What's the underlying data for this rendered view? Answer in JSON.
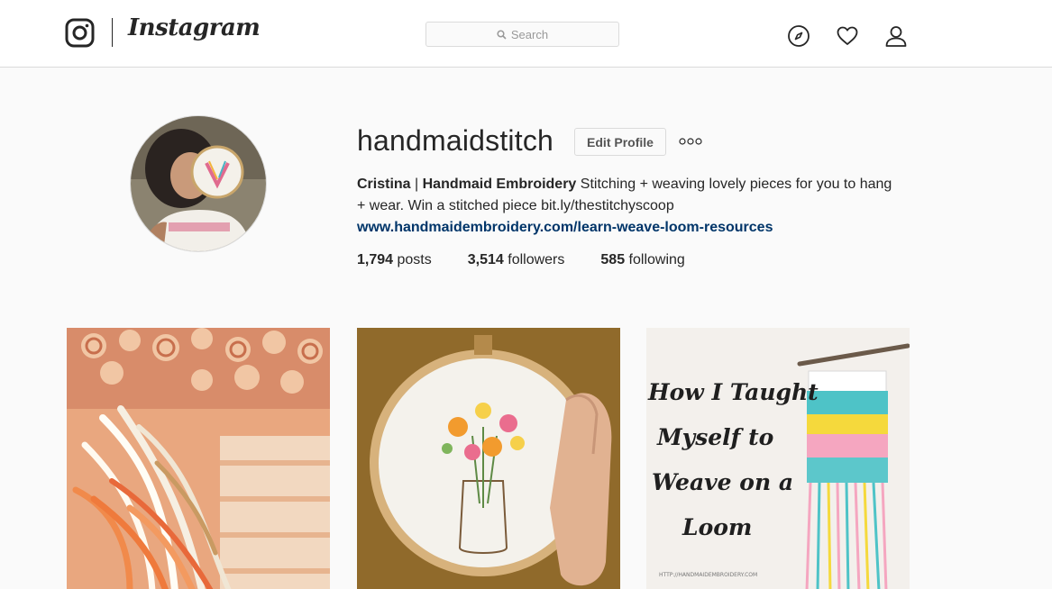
{
  "brand": {
    "wordmark": "Instagram",
    "logo_icon": "instagram-camera-icon"
  },
  "search": {
    "placeholder": "Search",
    "icon": "search-icon"
  },
  "nav": {
    "icons": [
      "compass-icon",
      "heart-icon",
      "person-icon"
    ]
  },
  "profile": {
    "username": "handmaidstitch",
    "edit_label": "Edit Profile",
    "more_icon": "ellipsis-icon",
    "bio": {
      "name_first": "Cristina",
      "separator": " | ",
      "name_rest": "Handmaid Embroidery",
      "text_line1": " Stitching + weaving lovely pieces for you to hang",
      "text_line2": "+ wear. Win a stitched piece bit.ly/thestitchyscoop",
      "link": "www.handmaidembroidery.com/learn-weave-loom-resources"
    },
    "stats": [
      {
        "count": "1,794",
        "label": "posts"
      },
      {
        "count": "3,514",
        "label": "followers"
      },
      {
        "count": "585",
        "label": "following"
      }
    ]
  },
  "posts": [
    {
      "kind": "photo",
      "subject": "yarn-weaving-photo"
    },
    {
      "kind": "photo",
      "subject": "embroidery-hoop-photo"
    },
    {
      "kind": "photo",
      "subject": "weaving-tutorial-graphic",
      "overlay_lines": [
        "How I Taught",
        "Myself to",
        "Weave on a",
        "Loom"
      ],
      "footer_text": "HTTP://HANDMAIDEMBROIDERY.COM"
    }
  ],
  "colors": {
    "link": "#003569",
    "border": "#dbdbdb",
    "page_bg": "#fafafa"
  }
}
